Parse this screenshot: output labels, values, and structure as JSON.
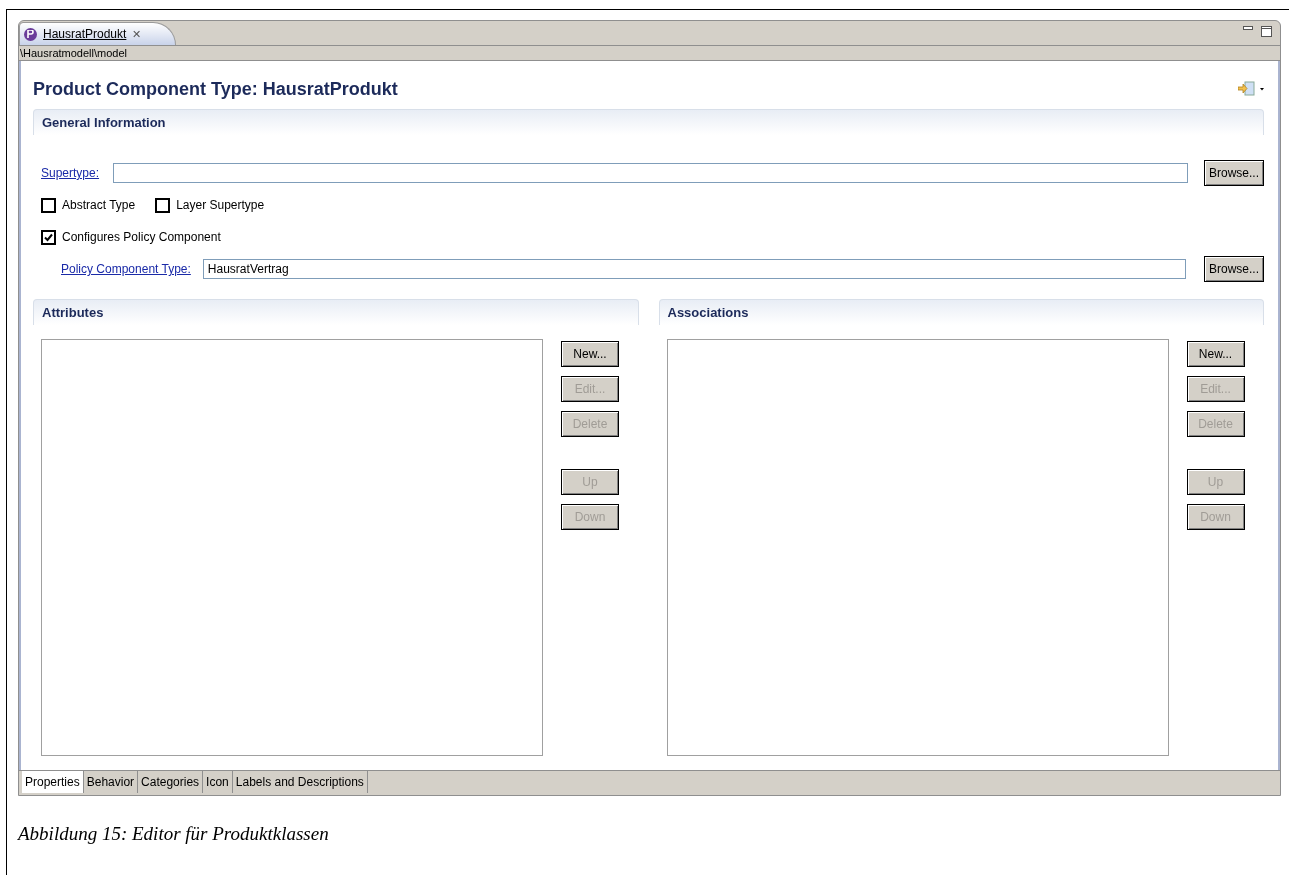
{
  "editor_tab": {
    "label": "HausratProdukt",
    "close": "✕"
  },
  "path": "\\Hausratmodell\\model",
  "title": "Product Component Type: HausratProdukt",
  "general": {
    "heading": "General Information",
    "supertype": {
      "label": "Supertype:",
      "button": "Browse..."
    },
    "checkboxes": [
      {
        "label": "Abstract Type",
        "checked": false
      },
      {
        "label": "Layer Supertype",
        "checked": false
      }
    ],
    "configures": {
      "label": "Configures Policy Component",
      "checked": true
    },
    "policy": {
      "label": "Policy Component Type:",
      "value": "HausratVertrag",
      "button": "Browse..."
    }
  },
  "sections": [
    {
      "heading": "Attributes",
      "buttons": [
        {
          "label": "New...",
          "enabled": true
        },
        {
          "label": "Edit...",
          "enabled": false
        },
        {
          "label": "Delete",
          "enabled": false
        },
        {
          "label": "Up",
          "enabled": false
        },
        {
          "label": "Down",
          "enabled": false
        }
      ]
    },
    {
      "heading": "Associations",
      "buttons": [
        {
          "label": "New...",
          "enabled": true
        },
        {
          "label": "Edit...",
          "enabled": false
        },
        {
          "label": "Delete",
          "enabled": false
        },
        {
          "label": "Up",
          "enabled": false
        },
        {
          "label": "Down",
          "enabled": false
        }
      ]
    }
  ],
  "bottom_tabs": [
    {
      "label": "Properties",
      "selected": true
    },
    {
      "label": "Behavior",
      "selected": false
    },
    {
      "label": "Categories",
      "selected": false
    },
    {
      "label": "Icon",
      "selected": false
    },
    {
      "label": "Labels and Descriptions",
      "selected": false
    }
  ],
  "caption": "Abbildung 15: Editor für Produktklassen"
}
